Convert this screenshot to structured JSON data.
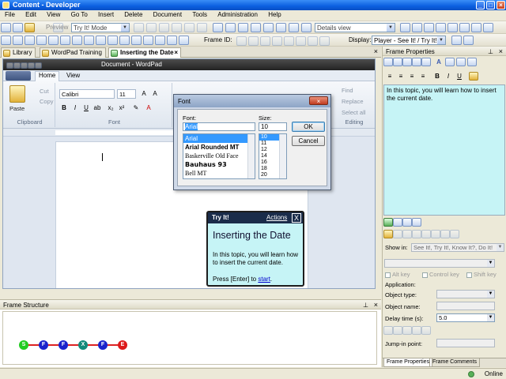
{
  "window": {
    "title": "Content - Developer"
  },
  "menu": [
    "File",
    "Edit",
    "View",
    "Go To",
    "Insert",
    "Delete",
    "Document",
    "Tools",
    "Administration",
    "Help"
  ],
  "toolbar1": {
    "preview_label": "Preview",
    "mode_value": "Try It! Mode",
    "view_value": "Details view"
  },
  "toolbar2": {
    "frame_id_label": "Frame ID:",
    "display_label": "Display:",
    "display_value": "Player - See It! / Try It!"
  },
  "doc_tabs": [
    {
      "label": "Library",
      "active": false
    },
    {
      "label": "WordPad Training",
      "active": false
    },
    {
      "label": "Inserting the Date",
      "active": true
    }
  ],
  "wordpad": {
    "title": "Document - WordPad",
    "tabs": [
      "Home",
      "View"
    ],
    "paste_label": "Paste",
    "cut_label": "Cut",
    "copy_label": "Copy",
    "clipboard_label": "Clipboard",
    "font_name": "Calibri",
    "font_size": "11",
    "font_group_label": "Font",
    "find_label": "Find",
    "replace_label": "Replace",
    "select_all_label": "Select all",
    "editing_label": "Editing"
  },
  "font_dialog": {
    "title": "Font",
    "font_label": "Font:",
    "size_label": "Size:",
    "font_value": "Arial",
    "size_value": "10",
    "fonts": [
      "Arial",
      "Arial Rounded MT",
      "Baskerville Old Face",
      "Bauhaus 93",
      "Bell MT"
    ],
    "sizes": [
      "10",
      "11",
      "12",
      "14",
      "16",
      "18",
      "20"
    ],
    "ok_label": "OK",
    "cancel_label": "Cancel"
  },
  "tryit": {
    "header": "Try It!",
    "actions": "Actions",
    "close": "X",
    "title": "Inserting the Date",
    "body": "In this topic, you will learn how to insert the current date.",
    "press_prefix": "Press [Enter] to ",
    "press_link": "start",
    "press_suffix": "."
  },
  "frame_structure": {
    "title": "Frame Structure",
    "nodes": [
      {
        "label": "S",
        "color": "#22cc22"
      },
      {
        "label": "F",
        "color": "#1a22cc"
      },
      {
        "label": "F",
        "color": "#1a22cc"
      },
      {
        "label": "X",
        "color": "#148a7a"
      },
      {
        "label": "F",
        "color": "#1a22cc"
      },
      {
        "label": "E",
        "color": "#dd1a1a"
      }
    ]
  },
  "frame_properties": {
    "title": "Frame Properties",
    "content_text": "In this topic, you will learn how to insert the current date.",
    "show_in_label": "Show in:",
    "show_in_value": "See It!, Try It!, Know It?, Do It!",
    "alt_key": "Alt key",
    "control_key": "Control key",
    "shift_key": "Shift key",
    "application_label": "Application:",
    "object_type_label": "Object type:",
    "object_name_label": "Object name:",
    "delay_label": "Delay time (s):",
    "delay_value": "5.0",
    "jump_in_label": "Jump-in point:",
    "tabs": [
      "Frame Properties",
      "Frame Comments"
    ]
  },
  "status": {
    "online": "Online"
  },
  "colors": {
    "accent": "#0b5fe0",
    "bubble": "#c6f4f6"
  }
}
